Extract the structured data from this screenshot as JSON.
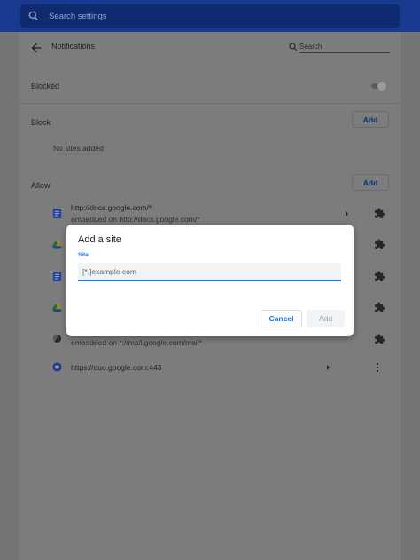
{
  "search": {
    "placeholder": "Search settings"
  },
  "header": {
    "title": "Notifications",
    "search_placeholder": "Search"
  },
  "blocked": {
    "label": "Blocked",
    "enabled": false
  },
  "block_section": {
    "label": "Block",
    "add_label": "Add",
    "empty_text": "No sites added"
  },
  "allow_section": {
    "label": "Allow",
    "add_label": "Add",
    "items": [
      {
        "url": "http://docs.google.com/*",
        "sub": "embedded on http://docs.google.com/*",
        "icon": "docs-icon"
      },
      {
        "url": "",
        "sub": "",
        "icon": "drive-icon"
      },
      {
        "url": "",
        "sub": "",
        "icon": "docs-icon"
      },
      {
        "url": "",
        "sub": "",
        "icon": "drive-icon"
      },
      {
        "url": "",
        "sub": "embedded on *://mail.google.com/mail*",
        "icon": "globe-icon"
      },
      {
        "url": "https://duo.google.com:443",
        "sub": "",
        "icon": "duo-icon"
      }
    ]
  },
  "dialog": {
    "title": "Add a site",
    "field_label": "Site",
    "field_placeholder": "[*.]example.com",
    "cancel_label": "Cancel",
    "add_label": "Add"
  },
  "colors": {
    "topbar": "#1a3a8f",
    "accent": "#1a73e8",
    "overlay": "#7c7c7c"
  }
}
